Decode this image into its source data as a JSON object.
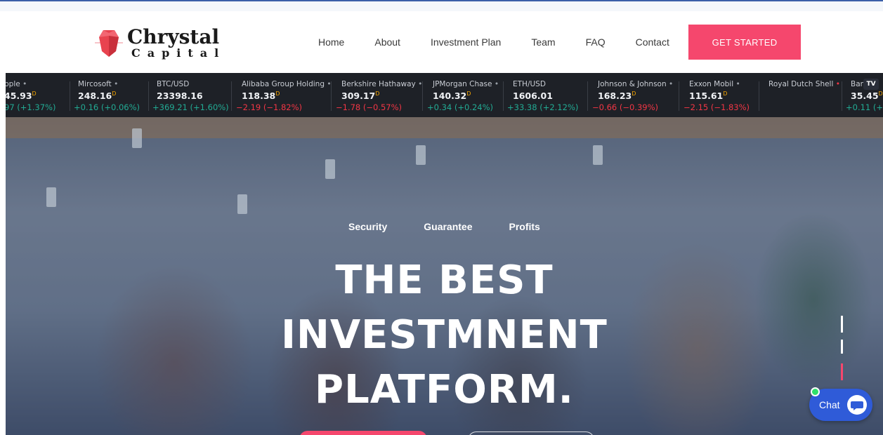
{
  "brand": {
    "line1": "Chrystal",
    "line2": "Capital",
    "gem_color": "#e8434f"
  },
  "nav": {
    "items": [
      "Home",
      "About",
      "Investment Plan",
      "Team",
      "FAQ",
      "Contact"
    ],
    "cta": "GET STARTED"
  },
  "ticker": [
    {
      "name": "pple",
      "price": "45.93",
      "change": "97 (+1.37%)",
      "dir": "up",
      "flag": "D"
    },
    {
      "name": "Mircosoft",
      "price": "248.16",
      "change": "+0.16 (+0.06%)",
      "dir": "up",
      "flag": "D"
    },
    {
      "name": "BTC/USD",
      "price": "23398.16",
      "change": "+369.21 (+1.60%)",
      "dir": "up",
      "flag": ""
    },
    {
      "name": "Alibaba Group Holding",
      "price": "118.38",
      "change": "−2.19 (−1.82%)",
      "dir": "down",
      "flag": "D"
    },
    {
      "name": "Berkshire Hathaway",
      "price": "309.17",
      "change": "−1.78 (−0.57%)",
      "dir": "down",
      "flag": "D"
    },
    {
      "name": "JPMorgan Chase",
      "price": "140.32",
      "change": "+0.34 (+0.24%)",
      "dir": "up",
      "flag": "D"
    },
    {
      "name": "ETH/USD",
      "price": "1606.01",
      "change": "+33.38 (+2.12%)",
      "dir": "up",
      "flag": ""
    },
    {
      "name": "Johnson & Johnson",
      "price": "168.23",
      "change": "−0.66 (−0.39%)",
      "dir": "down",
      "flag": "D"
    },
    {
      "name": "Exxon Mobil",
      "price": "115.61",
      "change": "−2.15 (−1.83%)",
      "dir": "down",
      "flag": "D"
    },
    {
      "name": "Royal Dutch Shell",
      "price": "",
      "change": "",
      "dir": "down",
      "flag": ""
    },
    {
      "name": "Banl",
      "price": "35.45",
      "change": "+0.11 (+",
      "dir": "up",
      "flag": "D"
    }
  ],
  "ticker_badge": "TV",
  "hero": {
    "tags": [
      "Security",
      "Guarantee",
      "Profits"
    ],
    "title_lines": [
      "THE BEST",
      "INVESTMNENT",
      "PLATFORM."
    ]
  },
  "chat": {
    "label": "Chat",
    "online_color": "#2ee06a"
  },
  "colors": {
    "accent": "#f5476d",
    "ticker_bg": "#1e2127",
    "up": "#22ab94",
    "down": "#f23645",
    "chat": "#2f5bd8"
  }
}
